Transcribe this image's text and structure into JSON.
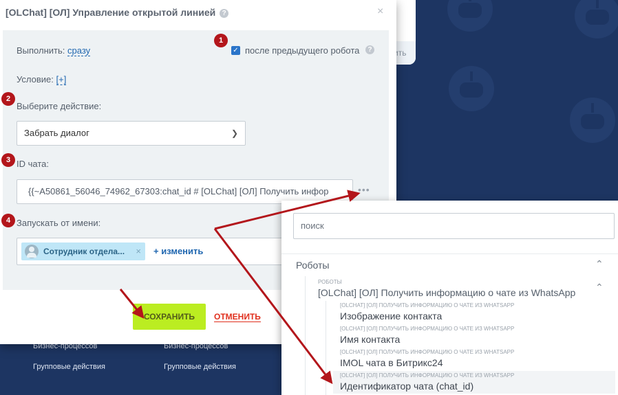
{
  "background": {
    "footer_col1": [
      "Бизнес-процессов",
      "Групповые действия"
    ],
    "footer_col2": [
      "Бизнес-процессов",
      "Групповые действия"
    ],
    "side_card_text": "ить"
  },
  "dialog": {
    "title": "[OLChat] [ОЛ] Управление открытой линией",
    "help_glyph": "?",
    "close_glyph": "×",
    "execute_label": "Выполнить:",
    "execute_value": "сразу",
    "after_previous_label": "после предыдущего робота",
    "after_previous_checked": true,
    "condition_label": "Условие:",
    "condition_value": "[+]",
    "action_label": "Выберите действие:",
    "action_value": "Забрать диалог",
    "chat_id_label": "ID чата:",
    "chat_id_value": "{{~A50861_56046_74962_67303:chat_id # [OLChat] [ОЛ] Получить инфор",
    "more_glyph": "•••",
    "run_as_label": "Запускать от имени:",
    "run_as_user": "Сотрудник отдела...",
    "run_as_change": "+ изменить",
    "save_label": "СОХРАНИТЬ",
    "cancel_label": "ОТМЕНИТЬ"
  },
  "badges": [
    "1",
    "2",
    "3",
    "4"
  ],
  "popup": {
    "search_placeholder": "поиск",
    "group_label": "Роботы",
    "sub_caption": "РОБОТЫ",
    "sub_title": "[OLChat] [ОЛ] Получить информацию о чате из WhatsApp",
    "items": [
      {
        "caption": "[OLCHAT] [ОЛ] ПОЛУЧИТЬ ИНФОРМАЦИЮ О ЧАТЕ ИЗ WHATSAPP",
        "name": "Изображение контакта"
      },
      {
        "caption": "[OLCHAT] [ОЛ] ПОЛУЧИТЬ ИНФОРМАЦИЮ О ЧАТЕ ИЗ WHATSAPP",
        "name": "Имя контакта"
      },
      {
        "caption": "[OLCHAT] [ОЛ] ПОЛУЧИТЬ ИНФОРМАЦИЮ О ЧАТЕ ИЗ WHATSAPP",
        "name": "IMOL чата в Битрикс24"
      },
      {
        "caption": "[OLCHAT] [ОЛ] ПОЛУЧИТЬ ИНФОРМАЦИЮ О ЧАТЕ ИЗ WHATSAPP",
        "name": "Идентификатор чата (chat_id)"
      }
    ]
  },
  "colors": {
    "accent_blue": "#2067b0",
    "save_green": "#bbed21",
    "cancel_red": "#e0301e",
    "badge_red": "#b3161b",
    "arrow_red": "#b3161b",
    "background_navy": "#1d3562"
  }
}
